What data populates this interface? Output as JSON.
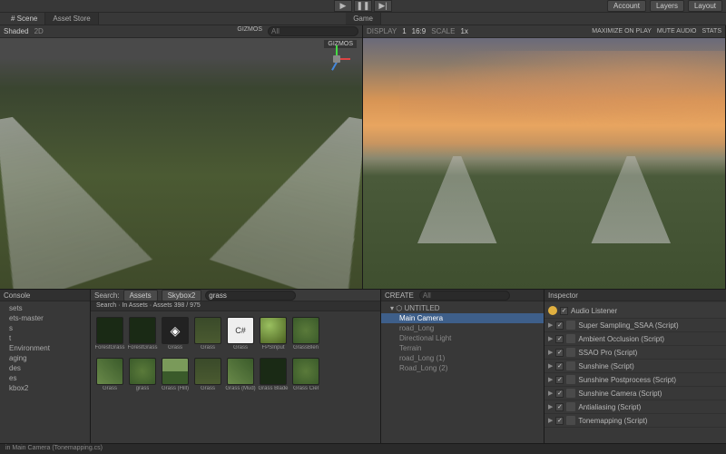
{
  "topmenu": {
    "account": "Account",
    "layers": "Layers",
    "layout": "Layout"
  },
  "playbar": {
    "play": "▶",
    "pause": "❚❚",
    "step": "▶|"
  },
  "tabs": {
    "scene": "# Scene",
    "game": "Game",
    "asset_store": "Asset Store"
  },
  "scene_header": {
    "shading": "Shaded",
    "mode": "2D",
    "gizmos": "GIZMOS",
    "search_placeholder": "All"
  },
  "game_header": {
    "display_label": "DISPLAY",
    "display_val": "1",
    "res_label": "16:9",
    "scale_label": "SCALE",
    "scale_val": "1x",
    "max": "MAXIMIZE ON PLAY",
    "mute": "MUTE AUDIO",
    "stats": "STATS"
  },
  "console_tab": "Console",
  "hierarchy_items": [
    "sets",
    "ets-master",
    "s",
    "t",
    "Environment",
    "aging",
    "des",
    "es",
    "kbox2"
  ],
  "project": {
    "search_label": "Search:",
    "filters": [
      "Assets",
      "Skybox2"
    ],
    "search_value": "grass",
    "breadcrumb": "Search · In Assets · Assets  398 / 975",
    "assets_r1": [
      "ForestGrass",
      "ForestGrass",
      "Grass",
      "Grass",
      "Grass",
      "FPSInput",
      "GrassBlen"
    ],
    "assets_r2": [
      "Grass",
      "grass",
      "Grass (Hill)",
      "Grass",
      "Grass (Mud)",
      "Grass Blade",
      "Grass Ciel"
    ]
  },
  "scene_hierarchy": {
    "create": "CREATE",
    "search_placeholder": "All",
    "root": "UNTITLED",
    "items": [
      "Main Camera",
      "road_Long",
      "Directional Light",
      "Terrain",
      "road_Long (1)",
      "Road_Long (2)"
    ]
  },
  "inspector": {
    "tab": "Inspector",
    "audio": "Audio Listener",
    "components": [
      "Super Sampling_SSAA (Script)",
      "Ambient Occlusion (Script)",
      "SSAO Pro (Script)",
      "Sunshine (Script)",
      "Sunshine Postprocess (Script)",
      "Sunshine Camera (Script)",
      "Antialiasing (Script)",
      "Tonemapping (Script)"
    ]
  },
  "statusbar": "in Main Camera (Tonemapping.cs)"
}
